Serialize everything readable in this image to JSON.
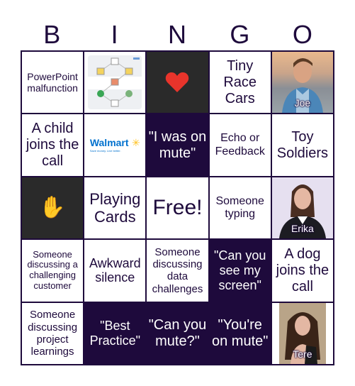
{
  "header": {
    "letters": [
      "B",
      "I",
      "N",
      "G",
      "O"
    ]
  },
  "colors": {
    "border": "#1e0a3c",
    "marked": "#1e0a3c",
    "dark_tile": "#2a2a2a",
    "heart": "#e8342b"
  },
  "cells": {
    "r0c0": "PowerPoint malfunction",
    "r0c1": "process-diagram-image",
    "r0c2": "heart-icon",
    "r0c3": "Tiny Race Cars",
    "r0c4": "Joe",
    "r1c0": "A child joins the call",
    "r1c1": "Walmart",
    "r1c1_tagline": "Save money. Live better.",
    "r1c2": "\"I was on mute\"",
    "r1c3": "Echo or Feedback",
    "r1c4": "Toy Soldiers",
    "r2c0": "raised-hand-icon",
    "r2c0_glyph": "✋",
    "r2c1": "Playing Cards",
    "r2c2": "Free!",
    "r2c3": "Someone typing",
    "r2c4": "Erika",
    "r3c0": "Someone discussing a challenging customer",
    "r3c1": "Awkward silence",
    "r3c2": "Someone discussing data challenges",
    "r3c3": "\"Can you see my screen\"",
    "r3c4": "A dog joins the call",
    "r4c0": "Someone discussing project learnings",
    "r4c1": "\"Best Practice\"",
    "r4c2": "\"Can you mute?\"",
    "r4c3": "\"You're on mute\"",
    "r4c4": "Tere"
  }
}
